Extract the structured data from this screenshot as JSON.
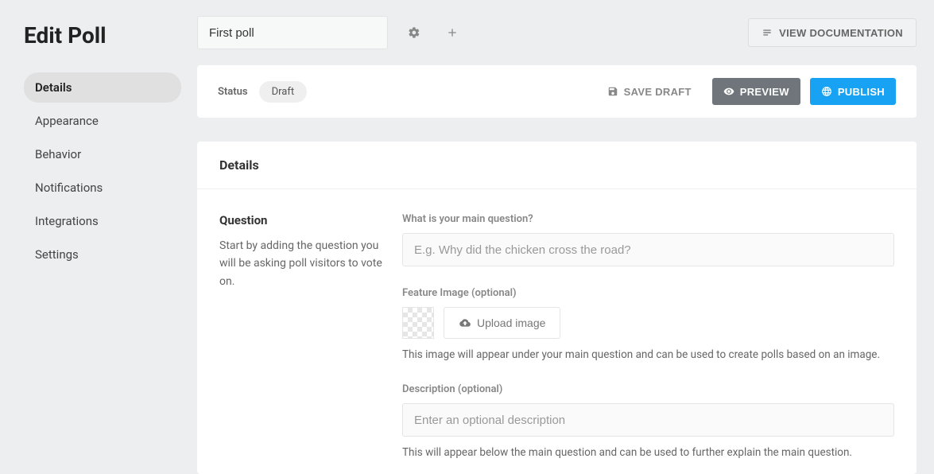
{
  "page": {
    "title": "Edit Poll"
  },
  "nav": {
    "items": [
      {
        "label": "Details"
      },
      {
        "label": "Appearance"
      },
      {
        "label": "Behavior"
      },
      {
        "label": "Notifications"
      },
      {
        "label": "Integrations"
      },
      {
        "label": "Settings"
      }
    ]
  },
  "topbar": {
    "poll_name": "First poll",
    "docs_label": "VIEW DOCUMENTATION"
  },
  "status": {
    "label": "Status",
    "value": "Draft",
    "save_draft": "SAVE DRAFT",
    "preview": "PREVIEW",
    "publish": "PUBLISH"
  },
  "details": {
    "heading": "Details",
    "question": {
      "title": "Question",
      "help": "Start by adding the question you will be asking poll visitors to vote on.",
      "label": "What is your main question?",
      "placeholder": "E.g. Why did the chicken cross the road?"
    },
    "feature_image": {
      "label": "Feature Image (optional)",
      "upload_label": "Upload image",
      "help": "This image will appear under your main question and can be used to create polls based on an image."
    },
    "description": {
      "label": "Description (optional)",
      "placeholder": "Enter an optional description",
      "help": "This will appear below the main question and can be used to further explain the main question."
    }
  }
}
